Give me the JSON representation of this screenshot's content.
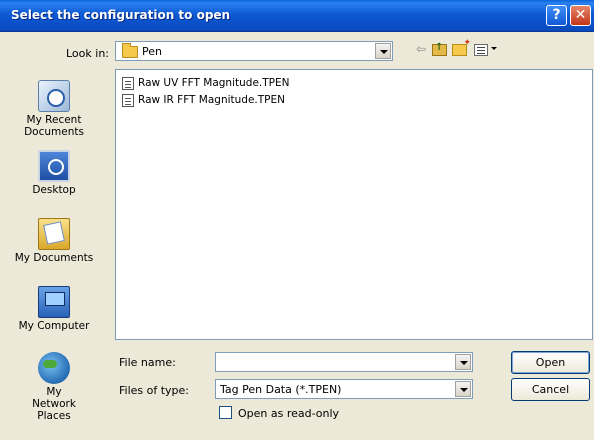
{
  "window": {
    "title": "Select the configuration to open",
    "help_glyph": "?",
    "close_glyph": "✕"
  },
  "toolbar": {
    "look_in_label": "Look in:",
    "look_in_value": "Pen",
    "icons": [
      "back-icon",
      "up-folder-icon",
      "new-folder-icon",
      "views-menu-icon"
    ],
    "back_glyph": "⇦"
  },
  "places": [
    {
      "label": "My Recent Documents",
      "icon": "recent-documents-icon"
    },
    {
      "label": "Desktop",
      "icon": "desktop-icon"
    },
    {
      "label": "My Documents",
      "icon": "my-documents-icon"
    },
    {
      "label": "My Computer",
      "icon": "my-computer-icon"
    },
    {
      "label": "My Network Places",
      "icon": "network-places-icon"
    }
  ],
  "files": [
    {
      "name": "Raw UV FFT Magnitude.TPEN"
    },
    {
      "name": "Raw IR FFT Magnitude.TPEN"
    }
  ],
  "form": {
    "file_name_label": "File name:",
    "file_name_value": "",
    "files_of_type_label": "Files of type:",
    "files_of_type_value": "Tag Pen Data (*.TPEN)",
    "open_read_only_label": "Open as read-only",
    "open_read_only_checked": false
  },
  "buttons": {
    "open": "Open",
    "cancel": "Cancel"
  },
  "colors": {
    "titlebar": "#0b4fc6",
    "dialog_bg": "#ece9d8",
    "field_border": "#7f9db9"
  }
}
